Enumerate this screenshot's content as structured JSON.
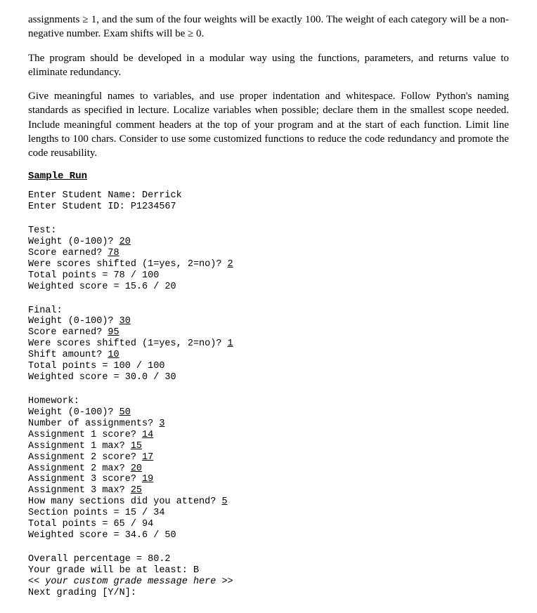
{
  "paragraphs": {
    "p1": "assignments ≥ 1, and the sum of the four weights will be exactly 100.  The weight of each category will be a non-negative number.  Exam shifts will be ≥ 0.",
    "p2": "The program should be developed in a modular way using the functions, parameters, and returns value to eliminate redundancy.",
    "p3": "Give meaningful names to variables, and use proper indentation and whitespace.  Follow Python's naming standards as specified in lecture.  Localize variables when possible; declare them in the smallest scope needed.  Include meaningful comment headers at the top of your program and at the start of each function.  Limit line lengths to 100 chars. Consider to use some customized functions to reduce the code redundancy and promote the code reusability."
  },
  "heading": "Sample Run",
  "run": {
    "intro": {
      "name_prompt": "Enter Student Name: Derrick",
      "id_prompt": "Enter Student ID: P1234567"
    },
    "test": {
      "label": "Test:",
      "weight": {
        "before": "Weight (0-100)? ",
        "value": "20"
      },
      "score": {
        "before": "Score earned? ",
        "value": "78"
      },
      "shifted": {
        "before": "Were scores shifted (1=yes, 2=no)? ",
        "value": "2"
      },
      "total": "Total points = 78 / 100",
      "weighted": "Weighted score = 15.6 / 20"
    },
    "final": {
      "label": "Final:",
      "weight": {
        "before": "Weight (0-100)? ",
        "value": "30"
      },
      "score": {
        "before": "Score earned? ",
        "value": "95"
      },
      "shifted": {
        "before": "Were scores shifted (1=yes, 2=no)? ",
        "value": "1"
      },
      "shiftamt": {
        "before": "Shift amount? ",
        "value": "10"
      },
      "total": "Total points = 100 / 100",
      "weighted": "Weighted score = 30.0 / 30"
    },
    "homework": {
      "label": "Homework:",
      "weight": {
        "before": "Weight (0-100)? ",
        "value": "50"
      },
      "numassn": {
        "before": "Number of assignments? ",
        "value": "3"
      },
      "a1s": {
        "before": "Assignment 1 score? ",
        "value": "14"
      },
      "a1m": {
        "before": "Assignment 1 max? ",
        "value": "15"
      },
      "a2s": {
        "before": "Assignment 2 score? ",
        "value": "17"
      },
      "a2m": {
        "before": "Assignment 2 max? ",
        "value": "20"
      },
      "a3s": {
        "before": "Assignment 3 score? ",
        "value": "19"
      },
      "a3m": {
        "before": "Assignment 3 max? ",
        "value": "25"
      },
      "sections": {
        "before": "How many sections did you attend? ",
        "value": "5"
      },
      "secpts": "Section points = 15 / 34",
      "total": "Total points = 65 / 94",
      "weighted": "Weighted score = 34.6 / 50"
    },
    "summary": {
      "overall": "Overall percentage = 80.2",
      "grade": "Your grade will be at least: B",
      "custom": "<< your custom grade message here >>",
      "next": "Next grading [Y/N]:"
    }
  }
}
